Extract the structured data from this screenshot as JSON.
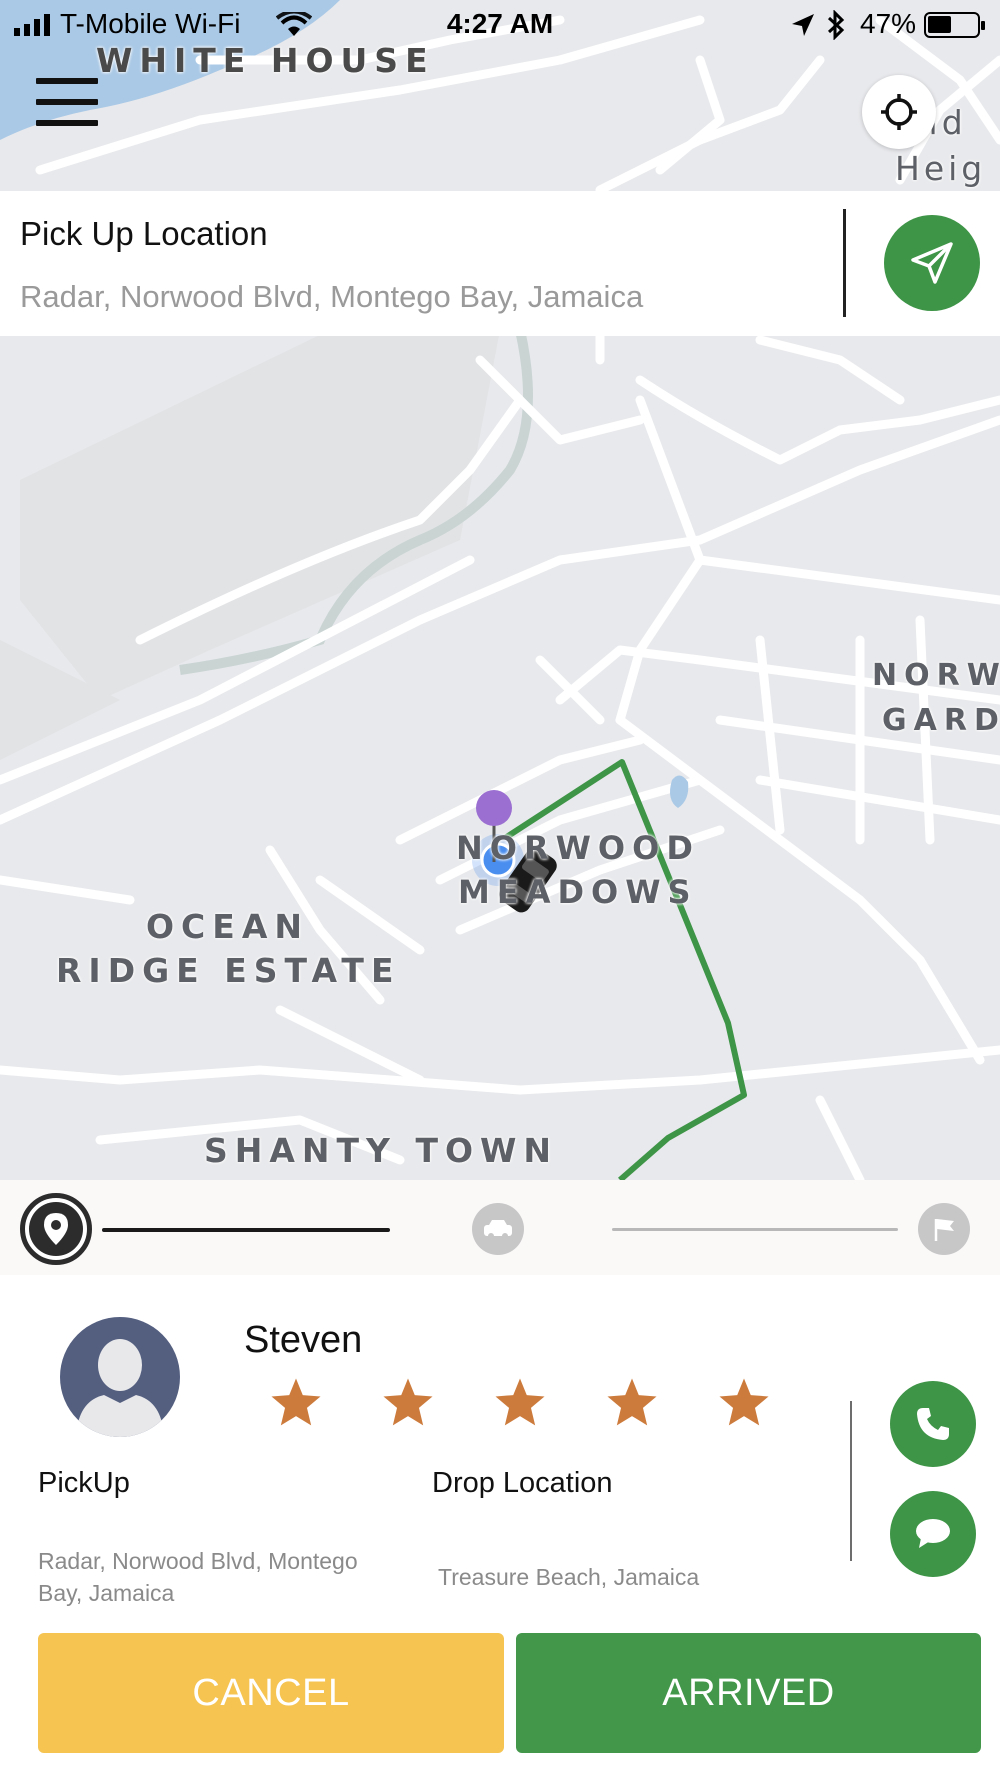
{
  "status_bar": {
    "carrier": "T-Mobile Wi-Fi",
    "time": "4:27 AM",
    "battery": "47%",
    "battery_level": 0.47
  },
  "map": {
    "labels": {
      "white_house": "WHITE HOUSE",
      "providence_a": "vid",
      "providence_b": "Heig",
      "norwood_gardens_a": "NORW",
      "norwood_gardens_b": "GARD",
      "norwood_meadows_a": "NORWOOD",
      "norwood_meadows_b": "MEADOWS",
      "ocean_ridge_a": "OCEAN",
      "ocean_ridge_b": "RIDGE ESTATE",
      "shanty_town": "SHANTY TOWN"
    },
    "route_color": "#3e9447"
  },
  "pickup_panel": {
    "title": "Pick Up Location",
    "address": "Radar, Norwood Blvd, Montego Bay, Jamaica"
  },
  "progress": {
    "steps": [
      "pickup-pin-icon",
      "car-icon",
      "finish-flag-icon"
    ],
    "current_step": 1
  },
  "driver_card": {
    "name": "Steven",
    "rating": 5,
    "rating_max": 5,
    "star_color": "#cd7b3c",
    "pickup_label": "PickUp",
    "pickup_address": "Radar, Norwood Blvd, Montego Bay, Jamaica",
    "drop_label": "Drop Location",
    "drop_address": "Treasure Beach, Jamaica"
  },
  "actions": {
    "cancel_label": "CANCEL",
    "arrived_label": "ARRIVED"
  },
  "colors": {
    "accent_green": "#3e9447",
    "cancel_yellow": "#f5c451",
    "avatar_bg": "#545f80"
  }
}
